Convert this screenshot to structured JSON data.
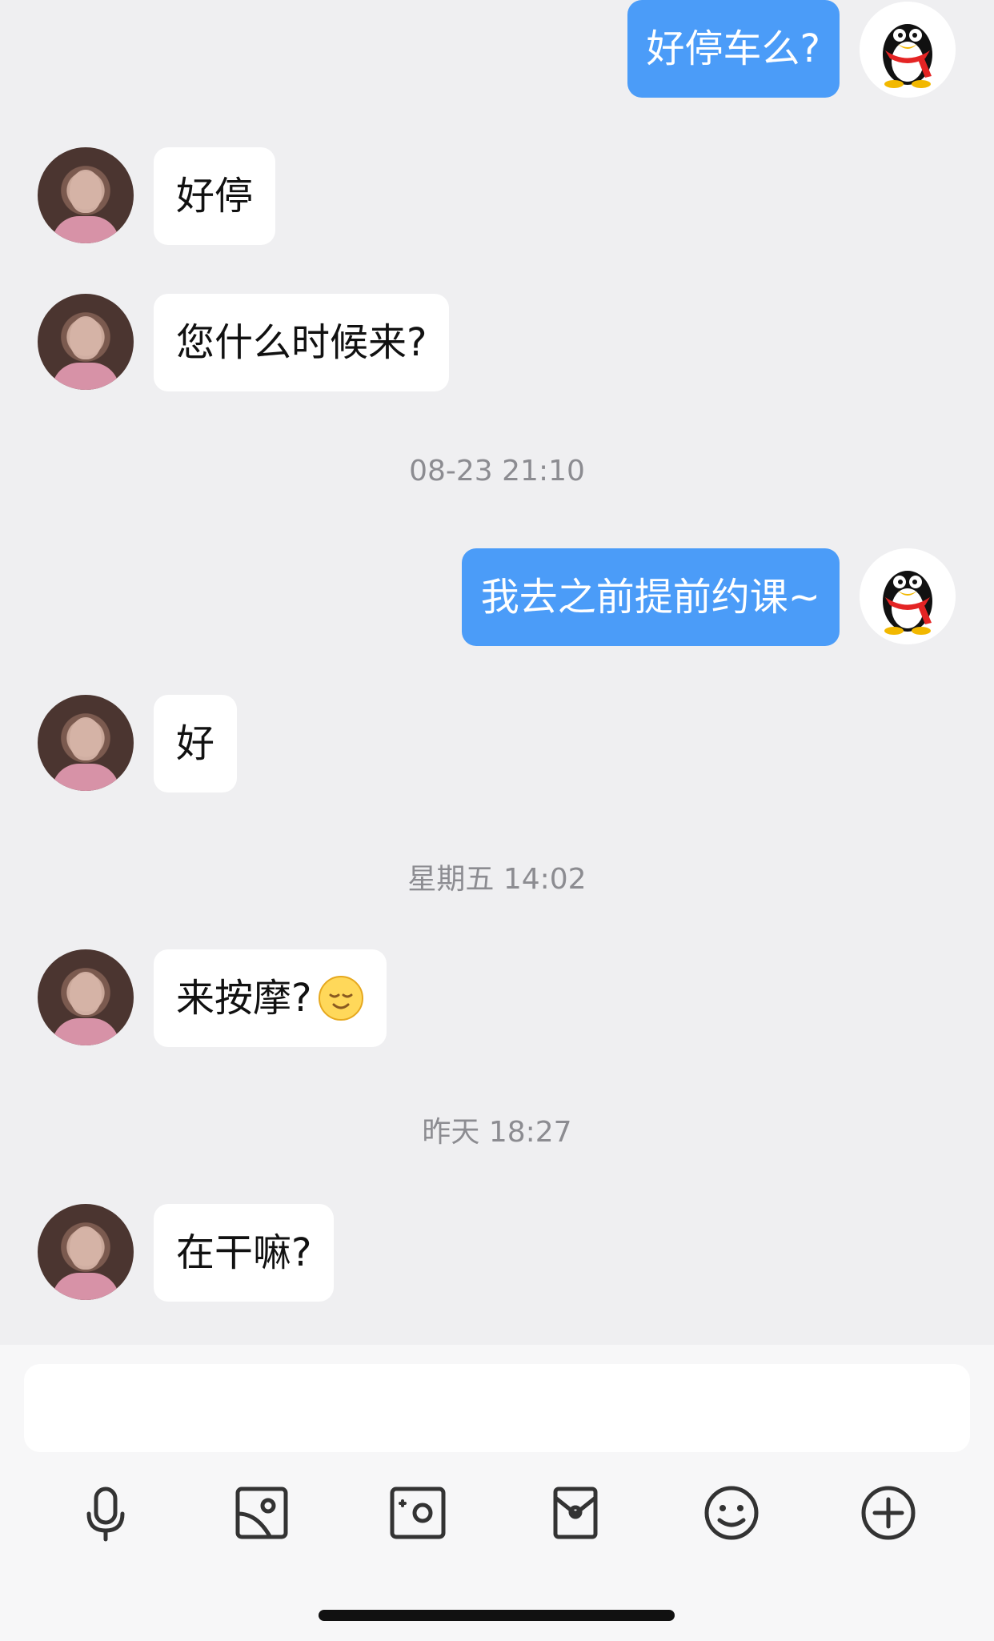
{
  "messages": [
    {
      "text": "好停车么?"
    },
    {
      "text": "好停"
    },
    {
      "text": "您什么时候来?"
    },
    {
      "text": "我去之前提前约课~"
    },
    {
      "text": "好"
    },
    {
      "text": "来按摩?"
    },
    {
      "text": "在干嘛?"
    }
  ],
  "timestamps": [
    {
      "text": "08-23 21:10"
    },
    {
      "text": "星期五 14:02"
    },
    {
      "text": "昨天 18:27"
    }
  ],
  "colors": {
    "chat_background": "#efeff1",
    "outgoing_bubble": "#4b9cf8",
    "incoming_bubble": "#ffffff",
    "timestamp_text": "#8c8c91",
    "toolbar_icon": "#333333"
  },
  "icons": {
    "self_avatar": "qq-penguin-icon",
    "emoji": "smiling-face-icon",
    "toolbar": [
      "microphone-icon",
      "image-icon",
      "camera-icon",
      "red-packet-icon",
      "emoji-icon",
      "plus-circle-icon"
    ]
  }
}
